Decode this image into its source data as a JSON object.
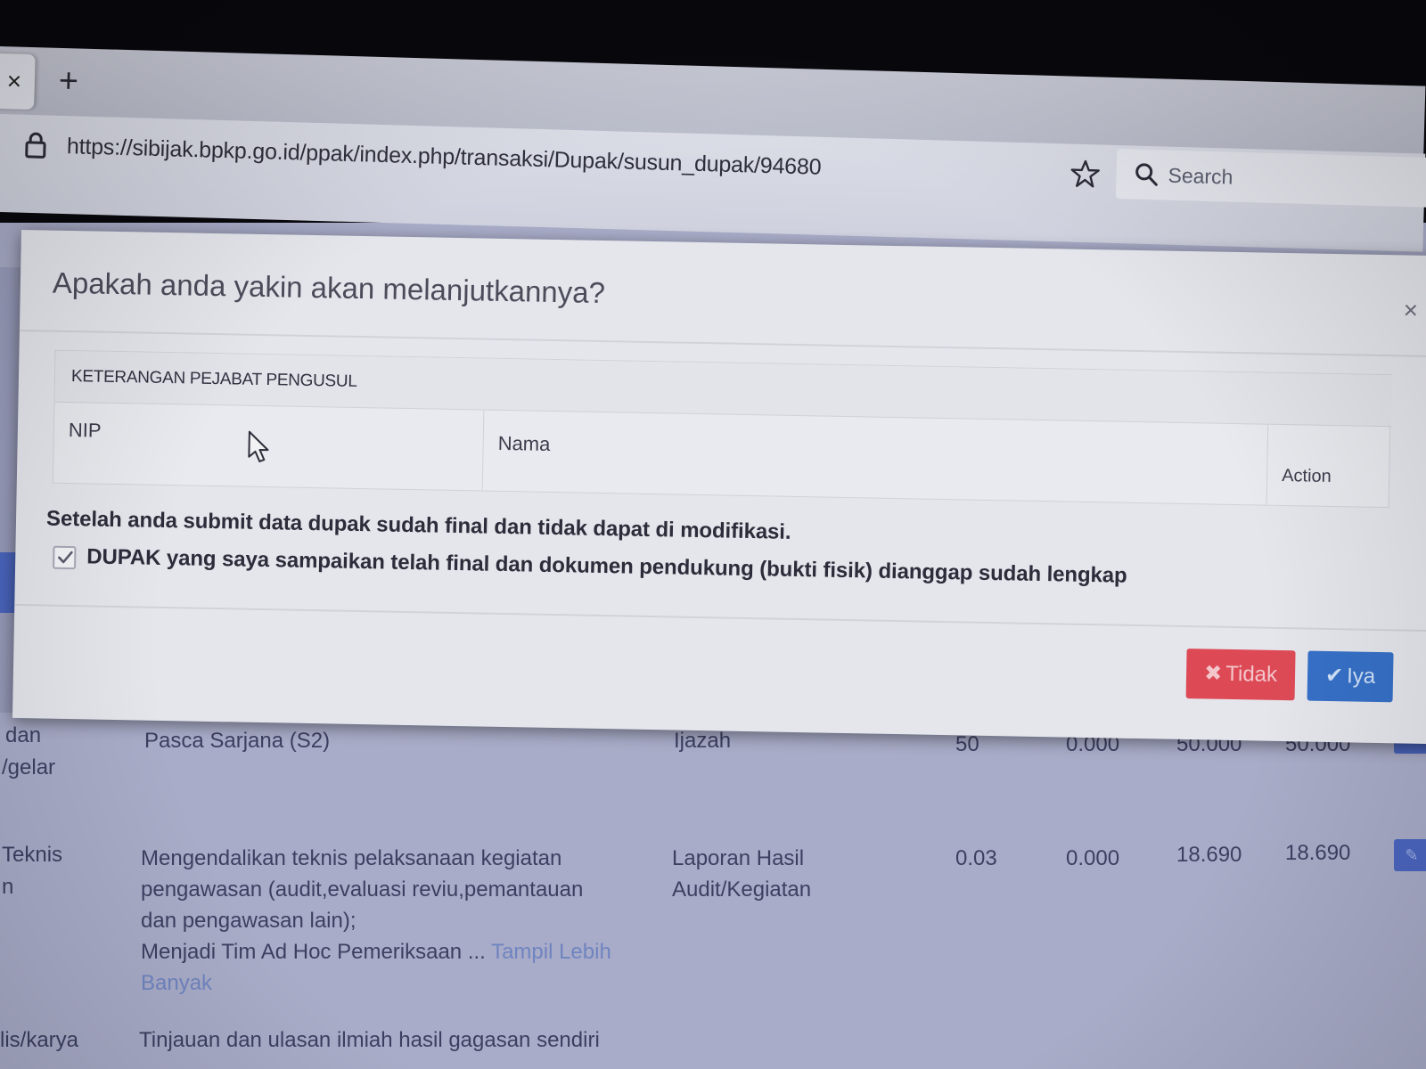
{
  "browser": {
    "tab_close_glyph": "×",
    "new_tab_glyph": "+",
    "url": "https://sibijak.bpkp.go.id/ppak/index.php/transaksi/Dupak/susun_dupak/94680",
    "search_placeholder": "Search"
  },
  "modal": {
    "title": "Apakah anda yakin akan melanjutkannya?",
    "close_glyph": "×",
    "panel_heading": "KETERANGAN PEJABAT PENGUSUL",
    "columns": {
      "nip": "NIP",
      "nama": "Nama",
      "action": "Action"
    },
    "warning": "Setelah anda submit data dupak sudah final dan tidak dapat di modifikasi.",
    "confirm_label": "DUPAK yang saya sampaikan telah final dan dokumen pendukung (bukti fisik) dianggap sudah lengkap",
    "confirm_checked": true,
    "buttons": {
      "no_icon": "✖",
      "no_label": "Tidak",
      "yes_icon": "✔",
      "yes_label": "Iya"
    }
  },
  "background_table": {
    "rows": [
      {
        "col1_a": "dan",
        "col1_b": "/gelar",
        "desc": "Pasca Sarjana (S2)",
        "evidence": "Ijazah",
        "v1": "50",
        "v2": "0.000",
        "v3": "50.000",
        "v4": "50.000"
      },
      {
        "col1_a": "Teknis",
        "col1_b": "n",
        "desc_l1": "Mengendalikan teknis pelaksanaan kegiatan",
        "desc_l2": "pengawasan (audit,evaluasi reviu,pemantauan",
        "desc_l3": "dan pengawasan lain);",
        "desc_l4": "Menjadi Tim Ad Hoc Pemeriksaan ...",
        "more_l1": "Tampil Lebih",
        "more_l2": "Banyak",
        "evidence_l1": "Laporan Hasil",
        "evidence_l2": "Audit/Kegiatan",
        "v1": "0.03",
        "v2": "0.000",
        "v3": "18.690",
        "v4": "18.690"
      },
      {
        "col1_a": "lis/karya",
        "desc": "Tinjauan dan ulasan ilmiah hasil gagasan sendiri"
      }
    ]
  },
  "colors": {
    "danger": "#dd4a56",
    "primary": "#3670c7"
  }
}
